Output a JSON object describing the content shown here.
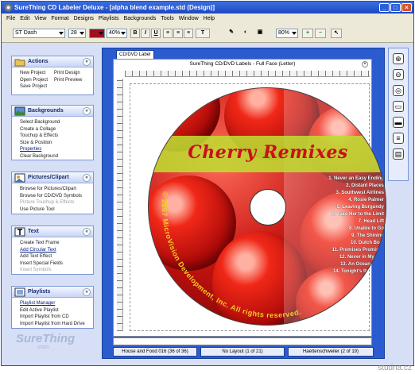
{
  "window": {
    "title": "SureThing CD Labeler Deluxe - [alpha blend example.std (Design)]"
  },
  "menu": [
    "File",
    "Edit",
    "View",
    "Format",
    "Designs",
    "Playlists",
    "Backgrounds",
    "Tools",
    "Window",
    "Help"
  ],
  "toolbar": {
    "font": "ST Dash",
    "size": "28",
    "zoom_text": "40%",
    "zoom_view": "80%",
    "bold": "B",
    "italic": "I",
    "underline": "U"
  },
  "sections": {
    "actions": {
      "title": "Actions",
      "left": [
        "New Project",
        "Open Project",
        "Save Project"
      ],
      "right": [
        "Print Design",
        "Print Preview"
      ]
    },
    "backgrounds": {
      "title": "Backgrounds",
      "items": [
        "Select Background",
        "Create a Collage",
        "Touchup & Effects",
        "Size & Position",
        "Properties",
        "Clear Background"
      ]
    },
    "pictures": {
      "title": "Pictures/Clipart",
      "items": [
        "Browse for Pictures/Clipart",
        "Browse for CD/DVD Symbols",
        "Picture Touchup & Effects",
        "Use Picture Tool"
      ]
    },
    "text": {
      "title": "Text",
      "items": [
        "Create Text Frame",
        "Add Circular Text",
        "Add Text Effect",
        "Insert Special Fields",
        "Insert Symbols"
      ]
    },
    "playlists": {
      "title": "Playlists",
      "items": [
        "Playlist Manager",
        "Edit Active Playlist",
        "Import Playlist from CD",
        "Import Playlist from Hard Drive"
      ]
    }
  },
  "logo": {
    "main": "SureThing",
    "sub": ".com"
  },
  "tab": "CD/DVD Label",
  "document": {
    "title": "SureThing CD/DVD Labels - Full Face  (Letter)",
    "disc_title": "Cherry Remixes",
    "copyright": "© 2007 MicroVision Development, Inc. All rights reserved.",
    "tracks": [
      "1. Never an Easy Ending",
      "2. Distant Places",
      "3. Southwest Airlines",
      "4. Rosie Palmer",
      "5. Leaving Burgundy",
      "6. Take Her to the Limit",
      "7. Head Lift",
      "8. Unable to Go",
      "9. The Shining",
      "10. Dutch Boat",
      "11. Promises Promises",
      "12. Never in My Life",
      "13. An Ocean Apart",
      "14. Tonight's the Night"
    ]
  },
  "nav": {
    "background": "House and Food 016 (36 of 36)",
    "layout": "No Layout (1 of 21)",
    "font": "Haettenschweiler (2 of 19)"
  },
  "watermark": "studna.cz",
  "colors": {
    "accent": "#2a5cd0",
    "disc_band": "#bedc32",
    "disc_title": "#c9101a"
  }
}
